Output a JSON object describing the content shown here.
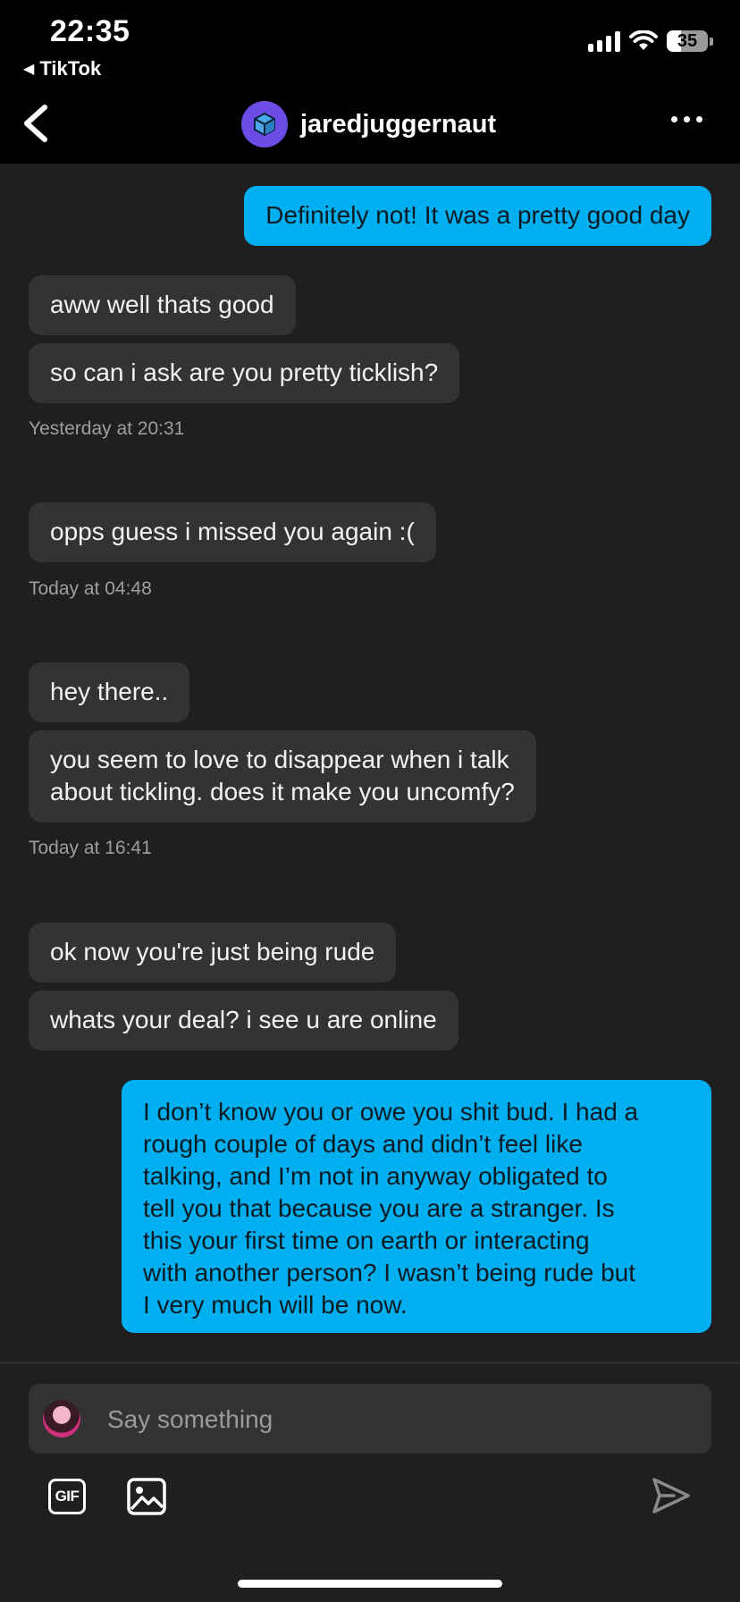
{
  "status": {
    "time": "22:35",
    "back_app": "TikTok",
    "battery": "35"
  },
  "header": {
    "username": "jaredjuggernaut"
  },
  "messages": [
    {
      "side": "out",
      "text": "Definitely not! It was a pretty good day"
    },
    {
      "side": "in",
      "text": "aww well thats good"
    },
    {
      "side": "in",
      "text": "so can i ask are you pretty ticklish?"
    },
    {
      "side": "in",
      "text": "opps guess i missed you again :("
    },
    {
      "side": "in",
      "text": "hey there.."
    },
    {
      "side": "in",
      "text": "you seem to love to disappear when i talk\nabout tickling. does it make you uncomfy?"
    },
    {
      "side": "in",
      "text": "ok now you're just being rude"
    },
    {
      "side": "in",
      "text": "whats your deal? i see u are online"
    },
    {
      "side": "out",
      "text": "I don’t know you or owe you shit bud. I had a\nrough couple of days and didn’t feel like\ntalking, and I’m not in anyway obligated to\ntell you that because you are a stranger. Is\nthis your first time on earth or interacting\nwith another person? I wasn’t being rude but\nI very much will be now."
    }
  ],
  "timestamps": [
    "Yesterday at 20:31",
    "Today at 04:48",
    "Today at 16:41"
  ],
  "composer": {
    "placeholder": "Say something",
    "gif_label": "GIF"
  },
  "colors": {
    "outgoing_bubble": "#00aff0",
    "incoming_bubble": "#333333",
    "background": "#1f1f1f"
  },
  "icons": [
    "back-arrow-icon",
    "cube-avatar-icon",
    "more-icon",
    "gif-icon",
    "image-icon",
    "send-icon"
  ]
}
